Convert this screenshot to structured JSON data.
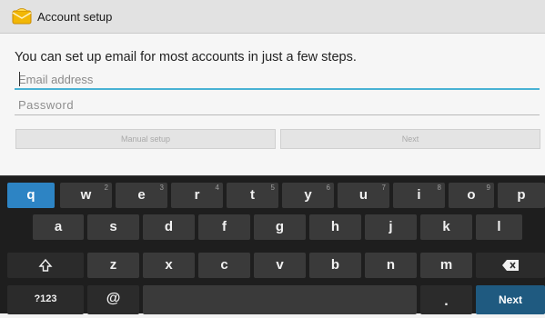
{
  "titlebar": {
    "title": "Account setup",
    "icon": "envelope-icon"
  },
  "form": {
    "instructions": "You can set up email for most accounts in just a few steps.",
    "email_placeholder": "Email address",
    "password_placeholder": "Password",
    "manual_setup_label": "Manual setup",
    "next_label": "Next"
  },
  "keyboard": {
    "row1": [
      {
        "label": "q",
        "hint": ""
      },
      {
        "label": "w",
        "hint": "2"
      },
      {
        "label": "e",
        "hint": "3"
      },
      {
        "label": "r",
        "hint": "4"
      },
      {
        "label": "t",
        "hint": "5"
      },
      {
        "label": "y",
        "hint": "6"
      },
      {
        "label": "u",
        "hint": "7"
      },
      {
        "label": "i",
        "hint": "8"
      },
      {
        "label": "o",
        "hint": "9"
      },
      {
        "label": "p",
        "hint": ""
      }
    ],
    "row2": [
      "a",
      "s",
      "d",
      "f",
      "g",
      "h",
      "j",
      "k",
      "l"
    ],
    "row3": [
      "z",
      "x",
      "c",
      "v",
      "b",
      "n",
      "m"
    ],
    "shift_icon": "shift-icon",
    "backspace_icon": "backspace-icon",
    "symbols_label": "?123",
    "at_label": "@",
    "period_label": ".",
    "next_label": "Next"
  }
}
